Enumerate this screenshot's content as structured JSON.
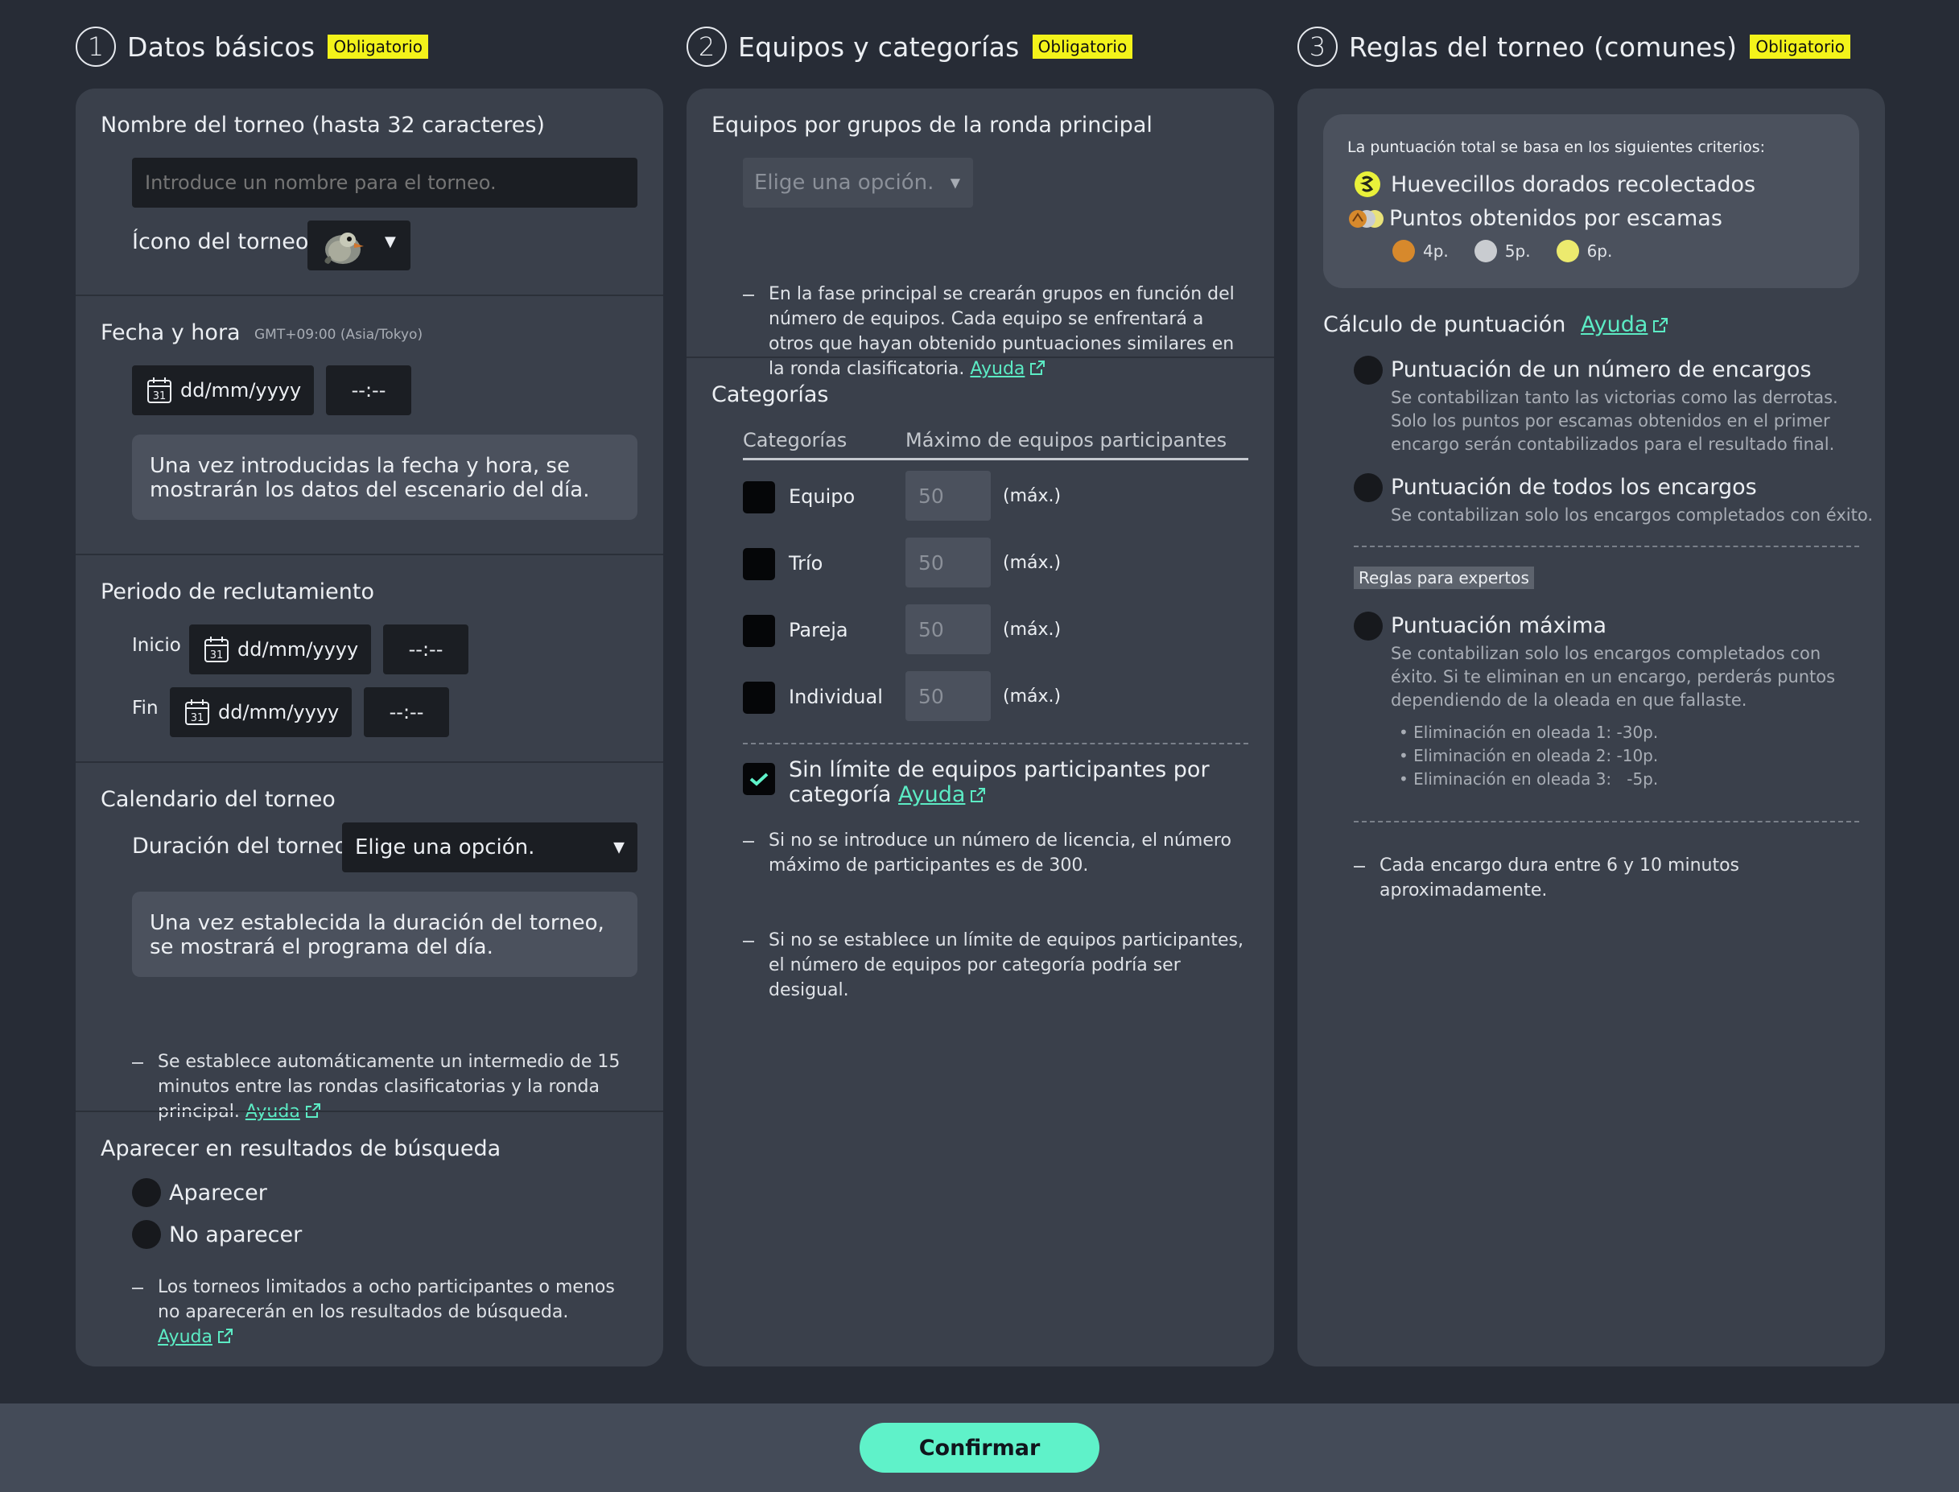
{
  "sections": [
    {
      "num": "1",
      "title": "Datos básicos",
      "badge": "Obligatorio"
    },
    {
      "num": "2",
      "title": "Equipos y categorías",
      "badge": "Obligatorio"
    },
    {
      "num": "3",
      "title": "Reglas del torneo (comunes)",
      "badge": "Obligatorio"
    }
  ],
  "basic": {
    "name_label": "Nombre del torneo (hasta 32 caracteres)",
    "name_placeholder": "Introduce un nombre para el torneo.",
    "icon_label": "Ícono del torneo",
    "datetime_label": "Fecha y hora",
    "timezone": "GMT+09:00 (Asia/Tokyo)",
    "date_placeholder": "dd/mm/yyyy",
    "time_placeholder": "--:--",
    "calendar_day": "31",
    "datetime_info": "Una vez introducidas la fecha y hora, se mostrarán los datos del escenario del día.",
    "recruit_label": "Periodo de reclutamiento",
    "start_label": "Inicio",
    "end_label": "Fin",
    "schedule_label": "Calendario del torneo",
    "duration_label": "Duración del torneo",
    "duration_value": "Elige una opción.",
    "schedule_info": "Una vez establecida la duración del torneo, se mostrará el programa del día.",
    "schedule_note": "Se establece automáticamente un intermedio de 15 minutos entre las rondas clasificatorias y la ronda principal.",
    "search_label": "Aparecer en resultados de búsqueda",
    "appear": "Aparecer",
    "not_appear": "No aparecer",
    "search_note": "Los torneos limitados a ocho participantes o menos no aparecerán en los resultados de búsqueda.",
    "help": "Ayuda"
  },
  "teams": {
    "groups_label": "Equipos por grupos de la ronda principal",
    "groups_value": "Elige una opción.",
    "groups_note": "En la fase principal se crearán grupos en función del número de equipos. Cada equipo se enfrentará a otros que hayan obtenido puntuaciones similares en la ronda clasificatoria.",
    "categories_label": "Categorías",
    "col_category": "Categorías",
    "col_max": "Máximo de equipos participantes",
    "rows": [
      {
        "name": "Equipo",
        "value": "50",
        "unit": "(máx.)"
      },
      {
        "name": "Trío",
        "value": "50",
        "unit": "(máx.)"
      },
      {
        "name": "Pareja",
        "value": "50",
        "unit": "(máx.)"
      },
      {
        "name": "Individual",
        "value": "50",
        "unit": "(máx.)"
      }
    ],
    "unlimited_line1": "Sin límite de equipos participantes por",
    "unlimited_line2": "categoría",
    "note1": "Si no se introduce un número de licencia, el número máximo de participantes es de 300.",
    "note2": "Si no se establece un límite de equipos participantes, el número de equipos por categoría podría ser desigual.",
    "help": "Ayuda"
  },
  "rules": {
    "criteria_title": "La puntuación total se basa en los siguientes criterios:",
    "crit1": "Huevecillos dorados recolectados",
    "crit2": "Puntos obtenidos por escamas",
    "scale_bronze": "4p.",
    "scale_silver": "5p.",
    "scale_gold": "6p.",
    "calc_label": "Cálculo de puntuación",
    "help": "Ayuda",
    "opt1_title": "Puntuación de un número de encargos",
    "opt1_desc": "Se contabilizan tanto las victorias como las derrotas. Solo los puntos por escamas obtenidos en el primer encargo serán contabilizados para el resultado final.",
    "opt2_title": "Puntuación de todos los encargos",
    "opt2_desc": "Se contabilizan solo los encargos completados con éxito.",
    "experts_badge": "Reglas para expertos",
    "opt3_title": "Puntuación máxima",
    "opt3_desc": "Se contabilizan solo los encargos completados con éxito. Si te eliminan en un encargo, perderás puntos dependiendo de la oleada en que fallaste.",
    "penalties": [
      "Eliminación en oleada 1: -30p.",
      "Eliminación en oleada 2: -10p.",
      "Eliminación en oleada 3:   -5p."
    ],
    "note": "Cada encargo dura entre 6 y 10 minutos aproximadamente."
  },
  "footer": {
    "confirm": "Confirmar"
  },
  "colors": {
    "accent": "#5ff2c9",
    "badge": "#f3f31a",
    "panel": "#3a404b",
    "background": "#272c36"
  }
}
